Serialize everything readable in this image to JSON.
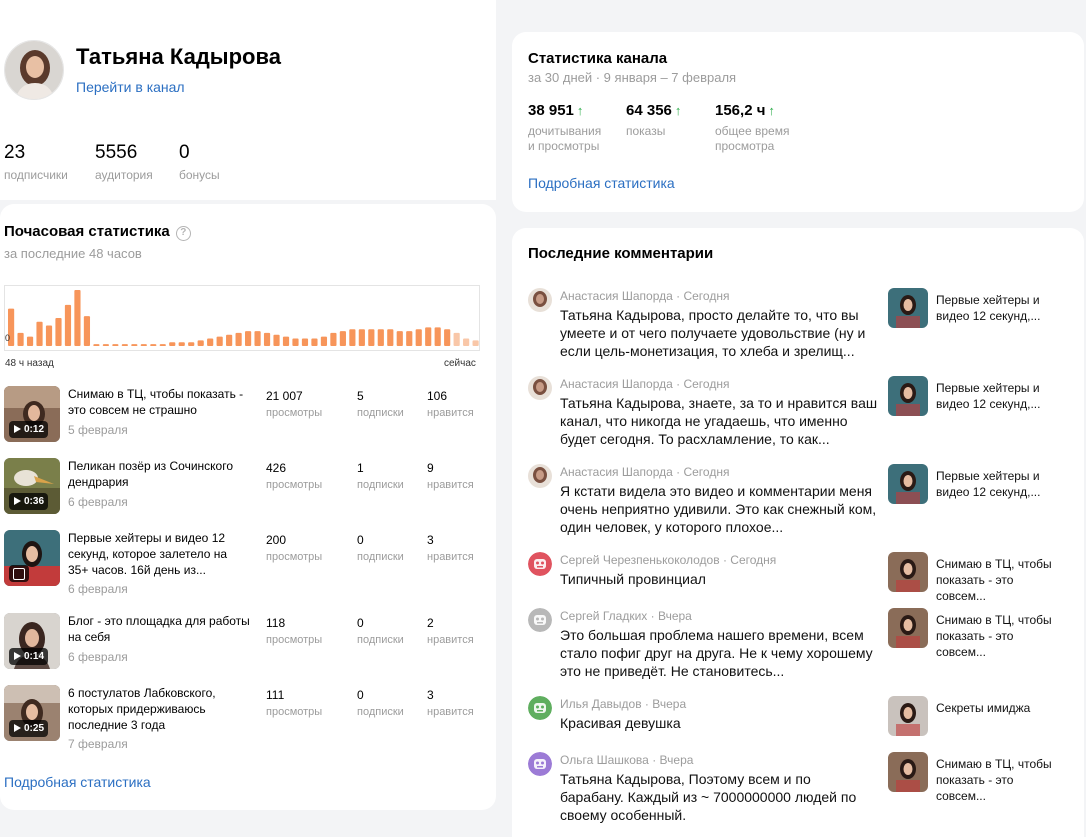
{
  "profile": {
    "name": "Татьяна Кадырова",
    "channel_link": "Перейти в канал",
    "stats": [
      {
        "value": "23",
        "label": "подписчики"
      },
      {
        "value": "5556",
        "label": "аудитория"
      },
      {
        "value": "0",
        "label": "бонусы"
      }
    ]
  },
  "hourly": {
    "title": "Почасовая статистика",
    "help_icon": "?",
    "subtitle": "за последние 48 часов",
    "axis_start": "48 ч назад",
    "axis_end": "сейчас",
    "zero_label": "0",
    "more_link": "Подробная статистика",
    "accent_color": "#f7955a",
    "chart_data": {
      "type": "bar",
      "title": "",
      "xlabel": "",
      "ylabel": "",
      "values": [
        20,
        7,
        5,
        13,
        11,
        15,
        22,
        30,
        16,
        1,
        1,
        1,
        1,
        1,
        1,
        1,
        1,
        2,
        2,
        2,
        3,
        4,
        5,
        6,
        7,
        8,
        8,
        7,
        6,
        5,
        4,
        4,
        4,
        5,
        7,
        8,
        9,
        9,
        9,
        9,
        9,
        8,
        8,
        9,
        10,
        10,
        9,
        7,
        4,
        3
      ],
      "faded_last": 3
    },
    "videos": [
      {
        "title": "Снимаю в ТЦ, чтобы показать - это совсем не страшно",
        "date": "5 февраля",
        "duration": "0:12",
        "views": "21 007",
        "views_label": "просмотры",
        "subs": "5",
        "subs_label": "подписки",
        "likes": "106",
        "likes_label": "нравится",
        "bg": "#8a6c58"
      },
      {
        "title": "Пеликан позёр из Сочинского дендрария",
        "date": "6 февраля",
        "duration": "0:36",
        "views": "426",
        "views_label": "просмотры",
        "subs": "1",
        "subs_label": "подписки",
        "likes": "9",
        "likes_label": "нравится",
        "bg": "#7a7f4a"
      },
      {
        "title": "Первые хейтеры и видео 12 секунд, которое залетело на 35+ часов. 16й день из...",
        "date": "6 февраля",
        "duration": "",
        "views": "200",
        "views_label": "просмотры",
        "subs": "0",
        "subs_label": "подписки",
        "likes": "3",
        "likes_label": "нравится",
        "bg": "#3d6f7a"
      },
      {
        "title": "Блог - это площадка для работы на себя",
        "date": "6 февраля",
        "duration": "0:14",
        "views": "118",
        "views_label": "просмотры",
        "subs": "0",
        "subs_label": "подписки",
        "likes": "2",
        "likes_label": "нравится",
        "bg": "#5c4a44"
      },
      {
        "title": "6 постулатов Лабковского, которых придерживаюсь последние 3 года",
        "date": "7 февраля",
        "duration": "0:25",
        "views": "111",
        "views_label": "просмотры",
        "subs": "0",
        "subs_label": "подписки",
        "likes": "3",
        "likes_label": "нравится",
        "bg": "#9b8270"
      }
    ]
  },
  "channel_stats": {
    "title": "Статистика канала",
    "subtitle": "за 30 дней · 9 января – 7 февраля",
    "trend_icon": "↑",
    "metrics": [
      {
        "value": "38 951",
        "label1": "дочитывания",
        "label2": "и просмотры"
      },
      {
        "value": "64 356",
        "label1": "показы",
        "label2": ""
      },
      {
        "value": "156,2 ч",
        "label1": "общее время",
        "label2": "просмотра"
      }
    ],
    "more_link": "Подробная статистика",
    "trend_color": "#2fae4c"
  },
  "comments": {
    "title": "Последние комментарии",
    "items": [
      {
        "author": "Анастасия Шапорда",
        "when": "Сегодня",
        "text": "Татьяна Кадырова, просто делайте то, что вы умеете и от чего получаете удовольствие (ну и если цель-монетизация, то хлеба и зрелищ...",
        "video": "Первые хейтеры и видео 12 секунд,...",
        "avatar_color": "#c79b86",
        "avatar_type": "photo",
        "thumb_color": "#3d6f7a"
      },
      {
        "author": "Анастасия Шапорда",
        "when": "Сегодня",
        "text": "Татьяна Кадырова, знаете, за то и нравится ваш канал, что никогда не угадаешь, что именно будет сегодня. То расхламление, то как...",
        "video": "Первые хейтеры и видео 12 секунд,...",
        "avatar_color": "#c79b86",
        "avatar_type": "photo",
        "thumb_color": "#3d6f7a"
      },
      {
        "author": "Анастасия Шапорда",
        "when": "Сегодня",
        "text": "Я кстати видела это видео и комментарии меня очень неприятно удивили. Это как снежный ком, один человек, у которого плохое...",
        "video": "Первые хейтеры и видео 12 секунд,...",
        "avatar_color": "#c79b86",
        "avatar_type": "photo",
        "thumb_color": "#3d6f7a"
      },
      {
        "author": "Сергей Черезпенькоколодов",
        "when": "Сегодня",
        "text": "Типичный провинциал",
        "video": "Снимаю в ТЦ, чтобы показать - это совсем...",
        "avatar_color": "#e0535f",
        "avatar_type": "robot",
        "thumb_color": "#8a6c58"
      },
      {
        "author": "Сергей Гладких",
        "when": "Вчера",
        "text": "Это большая проблема нашего времени, всем стало пофиг друг на друга. Не к чему хорошему это не приведёт. Не становитесь...",
        "video": "Снимаю в ТЦ, чтобы показать - это совсем...",
        "avatar_color": "#b8b8b8",
        "avatar_type": "robot",
        "thumb_color": "#8a6c58"
      },
      {
        "author": "Илья Давыдов",
        "when": "Вчера",
        "text": "Красивая девушка",
        "video": "Секреты имиджа",
        "avatar_color": "#5fae5f",
        "avatar_type": "robot",
        "thumb_color": "#c9c2bd"
      },
      {
        "author": "Ольга Шашкова",
        "when": "Вчера",
        "text": "Татьяна Кадырова, Поэтому всем и по барабану. Каждый из ~ 7000000000 людей по своему особенный.",
        "video": "Снимаю в ТЦ, чтобы показать - это совсем...",
        "avatar_color": "#9c7bd6",
        "avatar_type": "robot",
        "thumb_color": "#8a6c58"
      }
    ]
  }
}
